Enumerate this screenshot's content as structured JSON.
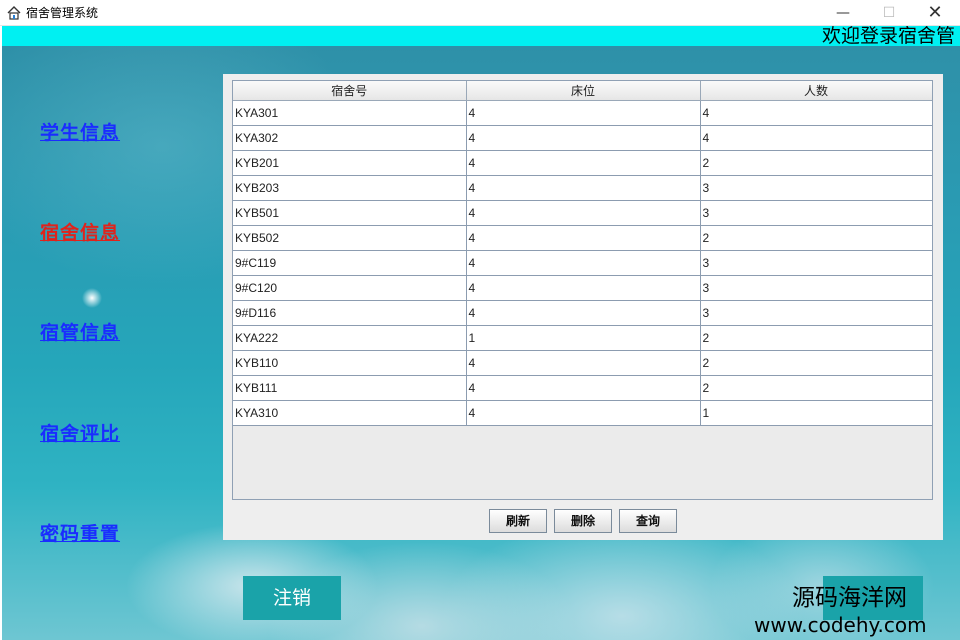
{
  "window": {
    "title": "宿舍管理系统",
    "minimize_glyph": "—",
    "maximize_glyph": "☐",
    "close_glyph": "✕",
    "icon": "house-icon"
  },
  "header": {
    "welcome_text": "欢迎登录宿舍管",
    "banner_color": "#00f0f2"
  },
  "sidebar": {
    "items": [
      {
        "label": "学生信息",
        "active": false
      },
      {
        "label": "宿舍信息",
        "active": true
      },
      {
        "label": "宿管信息",
        "active": false
      },
      {
        "label": "宿舍评比",
        "active": false
      },
      {
        "label": "密码重置",
        "active": false
      }
    ]
  },
  "table": {
    "columns": [
      "宿舍号",
      "床位",
      "人数"
    ],
    "rows": [
      [
        "KYA301",
        "4",
        "4"
      ],
      [
        "KYA302",
        "4",
        "4"
      ],
      [
        "KYB201",
        "4",
        "2"
      ],
      [
        "KYB203",
        "4",
        "3"
      ],
      [
        "KYB501",
        "4",
        "3"
      ],
      [
        "KYB502",
        "4",
        "2"
      ],
      [
        "9#C119",
        "4",
        "3"
      ],
      [
        "9#C120",
        "4",
        "3"
      ],
      [
        "9#D116",
        "4",
        "3"
      ],
      [
        "KYA222",
        "1",
        "2"
      ],
      [
        "KYB110",
        "4",
        "2"
      ],
      [
        "KYB111",
        "4",
        "2"
      ],
      [
        "KYA310",
        "4",
        "1"
      ]
    ]
  },
  "actions": {
    "refresh_label": "刷新",
    "delete_label": "删除",
    "query_label": "查询"
  },
  "footer": {
    "logout_label": "注销",
    "watermark_line1": "源码海洋网",
    "watermark_line2": "www.codehy.com",
    "accent_color": "#1aa3a9"
  }
}
